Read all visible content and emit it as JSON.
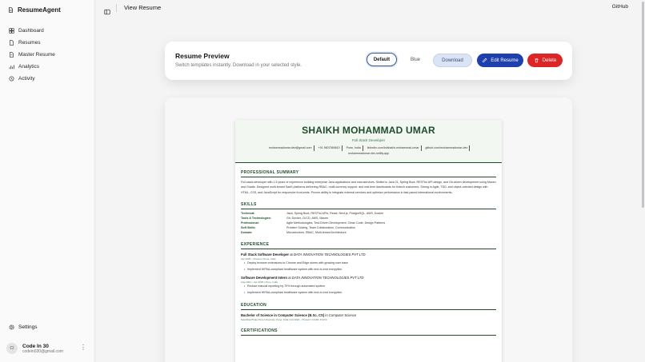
{
  "sidebar": {
    "brand": "ResumeAgent",
    "items": [
      {
        "label": "Dashboard",
        "icon": "dashboard-icon"
      },
      {
        "label": "Resumes",
        "icon": "file-icon"
      },
      {
        "label": "Master Resume",
        "icon": "file-icon"
      },
      {
        "label": "Analytics",
        "icon": "analytics-icon"
      },
      {
        "label": "Activity",
        "icon": "history-icon"
      }
    ],
    "settings_label": "Settings",
    "user": {
      "initials": "CI",
      "name": "Code In 30",
      "email": "codein030@gmail.com"
    }
  },
  "header": {
    "title": "View Resume",
    "github": "GitHub"
  },
  "preview": {
    "title": "Resume Preview",
    "subtitle": "Switch templates instantly. Download in your selected style.",
    "templates": [
      "Default",
      "Blue"
    ],
    "selected_template": "Default",
    "download": "Download",
    "edit": "Edit Resume",
    "delete": "Delete"
  },
  "resume": {
    "name": "SHAIKH MOHAMMAD UMAR",
    "role": "Full Stack Developer",
    "contacts": [
      "mohammadumar.dev@gmail.com",
      "+91 9607069810",
      "Pune, India",
      "linkedin.com/in/shaikh-mohammad-umar",
      "github.com/mohammadumar-dev",
      "mohammadumar-dev.netlify.app"
    ],
    "summary_heading": "PROFESSIONAL SUMMARY",
    "summary": "Full-stack developer with 1.5 years of experience building enterprise Java applications and microservices. Skilled in Java 21, Spring Boot, RESTful API design, and Git-driven development using Maven and Gradle. Designed multi-tenant SaaS platforms delivering RBAC, multi-currency support, and real-time dashboards for fintech customers. Strong in Agile, TDD, and object-oriented design with HTML, CSS, and JavaScript for responsive front-ends. Proven ability to integrate external services and optimize performance in fast-paced international environments.",
    "skills_heading": "SKILLS",
    "skills": [
      {
        "k": "Technical:",
        "v": "Java, Spring Boot, RESTful APIs, React, Next.js, PostgreSQL, AWS, Docker"
      },
      {
        "k": "Tools & Technologies:",
        "v": "Git, Docker, CI/CD, AWS, Maven"
      },
      {
        "k": "Professional:",
        "v": "Agile Methodologies, Test-Driven Development, Clean Code, Design Patterns"
      },
      {
        "k": "Soft Skills:",
        "v": "Problem Solving, Team Collaboration, Communication"
      },
      {
        "k": "Domain:",
        "v": "Microservices, RBAC, Multi-tenant Architecture"
      }
    ],
    "experience_heading": "EXPERIENCE",
    "jobs": [
      {
        "title": "Full Stack Software Developer",
        "at": "at",
        "company": "DATA INNOVATION TECHNOLOGIES PVT LTD",
        "meta": "Apr 2025 – Present | Pune, India",
        "bullets": [
          "Deploy browser extensions to Chrome and Edge stores with growing user base",
          "Implement HIPAA-compliant healthcare system with end-to-end encryption"
        ]
      },
      {
        "title": "Software Development Intern",
        "at": "at",
        "company": "DATA INNOVATION TECHNOLOGIES PVT LTD",
        "meta": "Aug 2024 – Apr 2025 | Pune, India",
        "bullets": [
          "Reduce manual reporting by 70% through automated system",
          "Implement HIPAA-compliant healthcare system with end-to-end encryption"
        ]
      }
    ],
    "education_heading": "EDUCATION",
    "education": {
      "degree": "Bachelor of Science in Computer Science (B.Sc. CS)",
      "in": "in Computer Science",
      "meta": "Savitribai Phule Pune University, Pune, India | Jul 2023 – Present | CGPA: 8.3/10"
    },
    "certifications_heading": "CERTIFICATIONS"
  }
}
